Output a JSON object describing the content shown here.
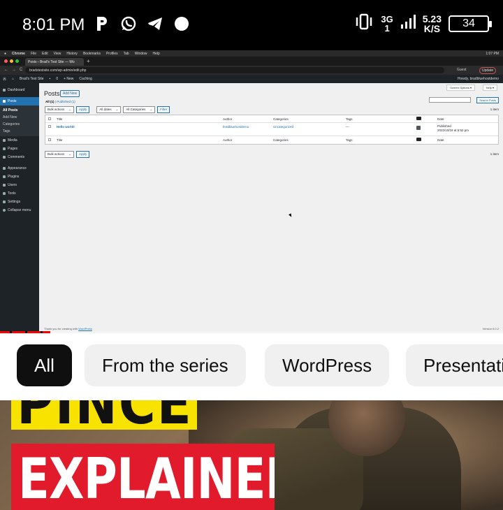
{
  "status_bar": {
    "time": "8:01 PM",
    "net_type": "3G",
    "net_sub": "1",
    "speed_value": "5.23",
    "speed_unit": "K/S",
    "battery": "34",
    "icons": [
      "p-icon",
      "whatsapp-icon",
      "telegram-icon",
      "dot-icon",
      "vibrate-icon",
      "signal-icon",
      "battery-icon"
    ]
  },
  "browser": {
    "menubar": [
      "Chrome",
      "File",
      "Edit",
      "View",
      "History",
      "Bookmarks",
      "Profiles",
      "Tab",
      "Window",
      "Help"
    ],
    "menubar_time": "1:07 PM",
    "tab_title": "Posts ‹ Brad's Test Site — Wo",
    "address": "bradstestsite.com/wp-admin/edit.php",
    "guest_label": "Guest",
    "update_label": "Update"
  },
  "wp": {
    "adminbar": {
      "site": "Brad's Test Site",
      "comments": "0",
      "new": "+ New",
      "caching": "Caching",
      "howdy": "Howdy, bradbluehostdemo"
    },
    "sidebar": {
      "dashboard": "Dashboard",
      "posts": "Posts",
      "sub": [
        "All Posts",
        "Add New",
        "Categories",
        "Tags"
      ],
      "items": [
        "Media",
        "Pages",
        "Comments",
        "Appearance",
        "Plugins",
        "Users",
        "Tools",
        "Settings",
        "Collapse menu"
      ]
    },
    "screen_options": "Screen Options ▾",
    "help": "Help ▾",
    "page_title": "Posts",
    "add_new": "Add New",
    "filter_all": "All (1)",
    "filter_sep": " | ",
    "filter_published": "Published (1)",
    "search_button": "Search Posts",
    "bulk_actions": "Bulk actions",
    "apply": "Apply",
    "all_dates": "All dates",
    "all_categories": "All Categories",
    "filter": "Filter",
    "item_count": "1 item",
    "columns": {
      "title": "Title",
      "author": "Author",
      "categories": "Categories",
      "tags": "Tags",
      "date": "Date"
    },
    "post": {
      "title": "Hello world!",
      "author": "bradbluehostdemo",
      "category": "Uncategorized",
      "tags": "—",
      "comments": "1",
      "status": "Published",
      "date": "2022/10/18 at 5:52 pm"
    },
    "footer_thanks_prefix": "Thank you for creating with ",
    "footer_thanks_link": "WordPress",
    "footer_version": "Version 6.0.2"
  },
  "video": {
    "progress": 0.1
  },
  "chips": [
    "All",
    "From the series",
    "WordPress",
    "Presentations"
  ],
  "thumbnail": {
    "line1": "PINCER",
    "line2": "EXPLAINED",
    "colors": {
      "yellow": "#f7e200",
      "red": "#e11b2b"
    }
  }
}
